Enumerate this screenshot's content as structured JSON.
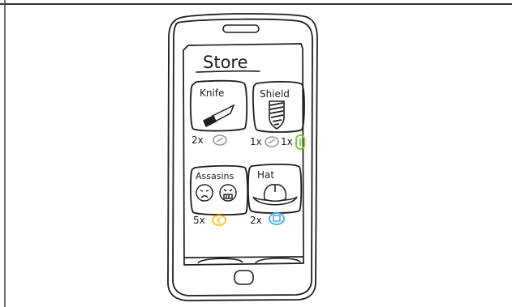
{
  "store": {
    "title": "Store",
    "items": [
      {
        "name": "Knife",
        "price": "2x",
        "currency_icon": "silver-coin-icon",
        "currency_color": "#9a9a9a",
        "image_icon": "knife-icon"
      },
      {
        "name": "Shield",
        "price": "1x",
        "currency_icon": "silver-coin-icon",
        "currency_color": "#9a9a9a",
        "price_extra": "1x",
        "extra_currency_icon": "green-gem-icon",
        "extra_currency_color": "#7ac943",
        "image_icon": "shield-icon"
      },
      {
        "name": "Assasins",
        "price": "5x",
        "currency_icon": "gold-coin-icon",
        "currency_color": "#f5c518",
        "image_icon": "assassins-faces-icon"
      },
      {
        "name": "Hat",
        "price": "2x",
        "currency_icon": "blue-gem-icon",
        "currency_color": "#3fa9f5",
        "image_icon": "hat-icon"
      }
    ]
  },
  "colors": {
    "ink": "#1e1e1e",
    "silver": "#9a9a9a",
    "gold": "#f5c518",
    "green": "#7ac943",
    "blue": "#3fa9f5"
  }
}
